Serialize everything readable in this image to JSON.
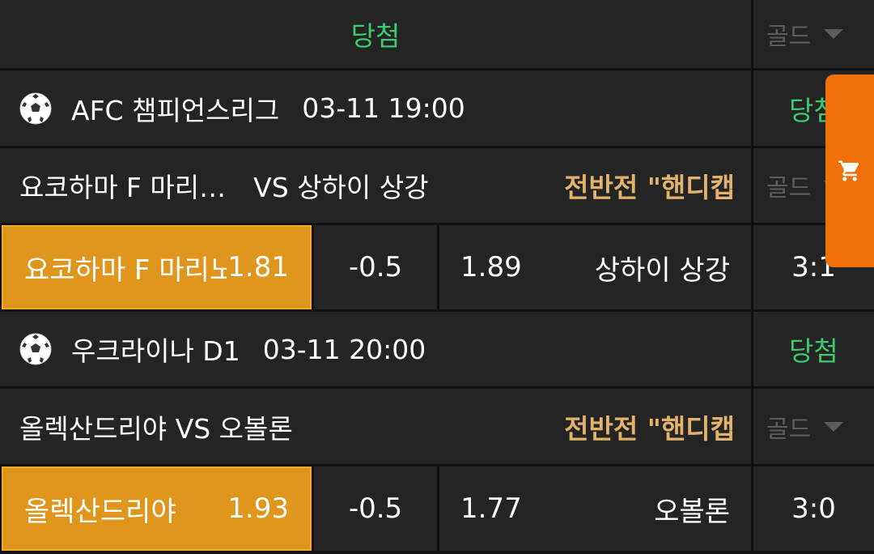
{
  "header": {
    "title": "당첨",
    "gold_dropdown": "골드"
  },
  "matches": [
    {
      "league": "AFC 챔피언스리그",
      "datetime": "03-11 19:00",
      "status": "당첨",
      "teams_text": "요코하마 F 마리…",
      "vs_text": "VS 상하이 상강",
      "bet_type": "전반전 \"핸디캡",
      "gold_dropdown": "골드",
      "home_name": "요코하마 F 마리노",
      "home_odds": "1.81",
      "handicap": "-0.5",
      "away_odds": "1.89",
      "away_name": "상하이 상강",
      "score": "3:1"
    },
    {
      "league": "우크라이나 D1",
      "datetime": "03-11 20:00",
      "status": "당첨",
      "teams_text": "올렉산드리야 VS 오볼론",
      "bet_type": "전반전 \"핸디캡",
      "gold_dropdown": "골드",
      "home_name": "올렉산드리야",
      "home_odds": "1.93",
      "handicap": "-0.5",
      "away_odds": "1.77",
      "away_name": "오볼론",
      "score": "3:0"
    }
  ],
  "icons": {
    "ball": "soccer-ball-icon",
    "cart": "shopping-cart-icon",
    "caret": "chevron-down-icon"
  },
  "colors": {
    "win_green": "#3ccb6e",
    "bet_type_gold": "#e3b26b",
    "selection_orange": "#e0961c",
    "cart_orange": "#f0700a"
  }
}
